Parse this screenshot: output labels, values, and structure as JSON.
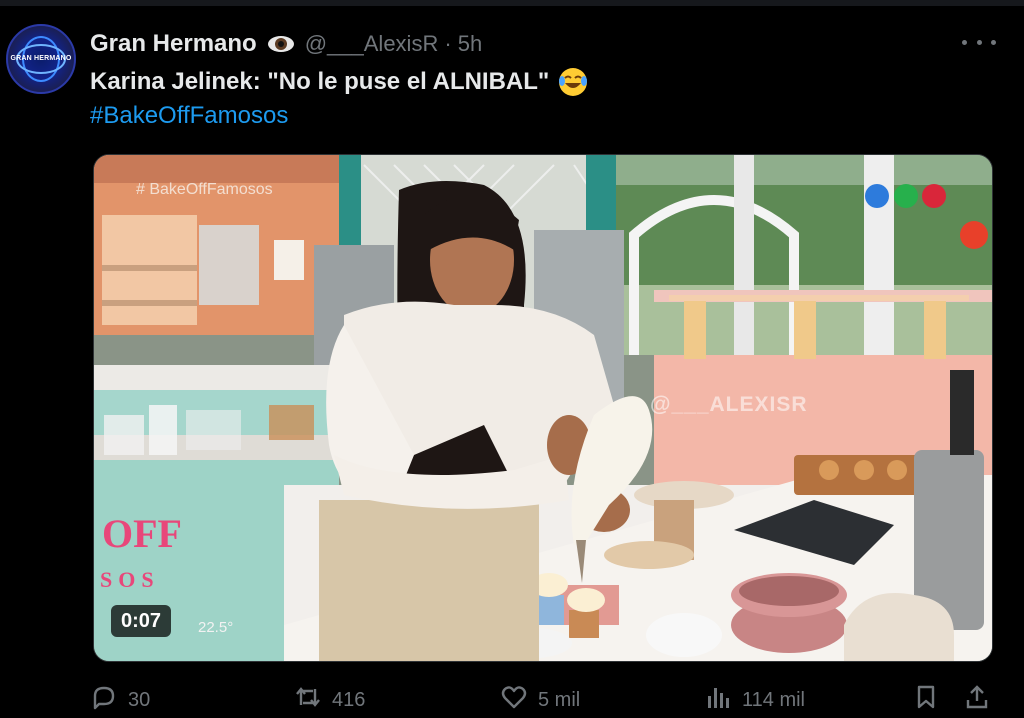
{
  "tweet": {
    "author_name": "Gran Hermano",
    "author_handle": "@___AlexisR",
    "time": "· 5h",
    "avatar_text": "GRAN HERMANO",
    "text": "Karina Jelinek: \"No le puse el ALNIBAL\"",
    "hashtag": "#BakeOffFamosos"
  },
  "media": {
    "overlay_hashtag": "# BakeOffFamosos",
    "watermark": "@___ALEXISR",
    "show_logo_text": "OFF",
    "show_logo_sub": "SOS",
    "video_time": "0:07",
    "temperature": "22.5°"
  },
  "actions": {
    "replies": "30",
    "retweets": "416",
    "likes": "5 mil",
    "views": "114 mil"
  },
  "icons": {
    "verified": "eye-icon",
    "emoji": "laughing-with-tears-emoji",
    "more": "more-options-icon",
    "reply": "reply-icon",
    "retweet": "retweet-icon",
    "like": "heart-icon",
    "views": "views-chart-icon",
    "bookmark": "bookmark-icon",
    "share": "share-icon"
  },
  "colors": {
    "background": "#000000",
    "text": "#e7e9ea",
    "muted": "#71767b",
    "link": "#1d9bf0"
  }
}
